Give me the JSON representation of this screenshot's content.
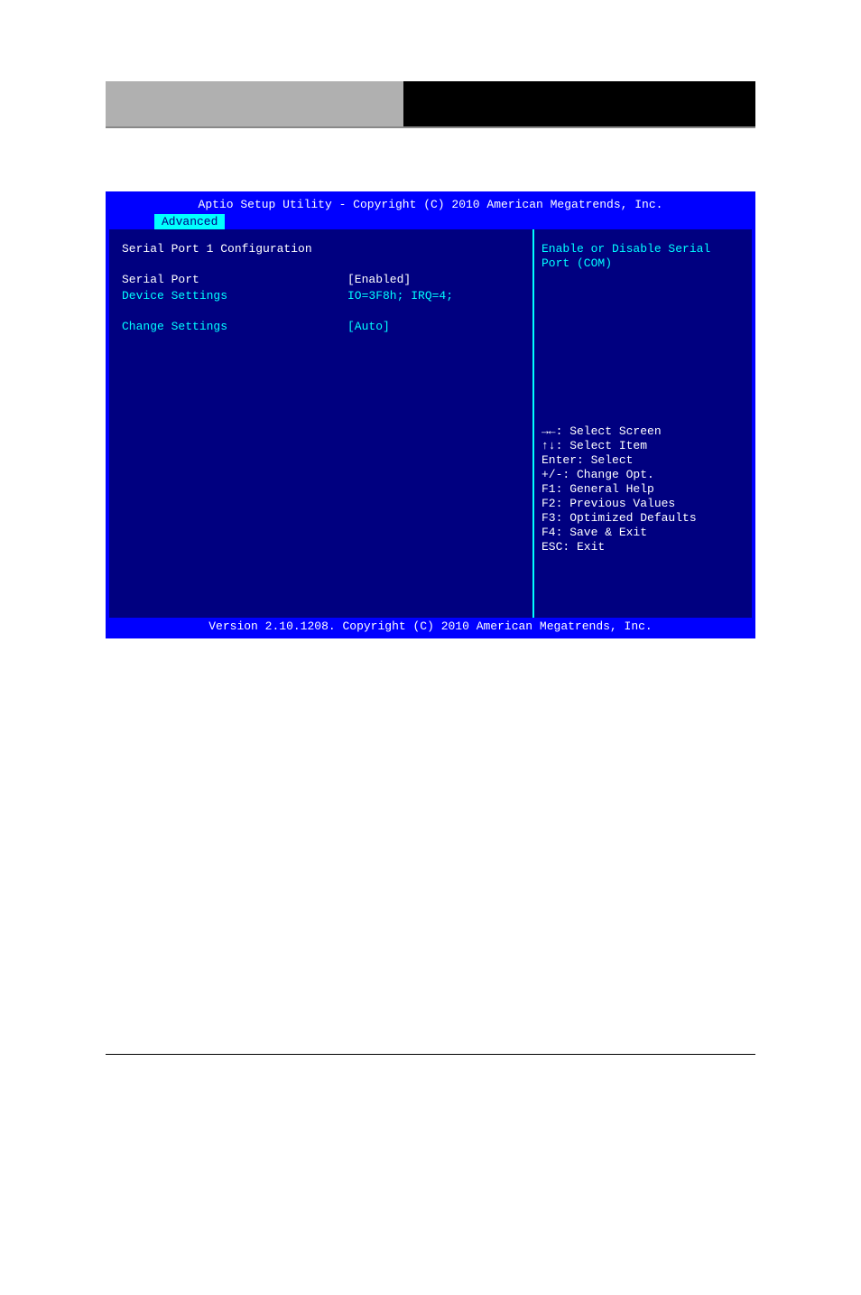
{
  "bios": {
    "title": "Aptio Setup Utility - Copyright (C) 2010 American Megatrends, Inc.",
    "tab": "Advanced",
    "section_heading": "Serial Port 1 Configuration",
    "rows": {
      "serial_port": {
        "label": "Serial Port",
        "value": "[Enabled]"
      },
      "device_settings": {
        "label": "Device Settings",
        "value": "IO=3F8h; IRQ=4;"
      },
      "change_settings": {
        "label": "Change Settings",
        "value": "[Auto]"
      }
    },
    "help_text": "Enable or Disable Serial Port (COM)",
    "nav_help": {
      "l1": "→←: Select Screen",
      "l2": "↑↓: Select Item",
      "l3": "Enter: Select",
      "l4": "+/-: Change Opt.",
      "l5": "F1: General Help",
      "l6": "F2: Previous Values",
      "l7": "F3: Optimized Defaults",
      "l8": "F4: Save & Exit",
      "l9": "ESC: Exit"
    },
    "footer": "Version 2.10.1208. Copyright (C) 2010 American Megatrends, Inc."
  }
}
